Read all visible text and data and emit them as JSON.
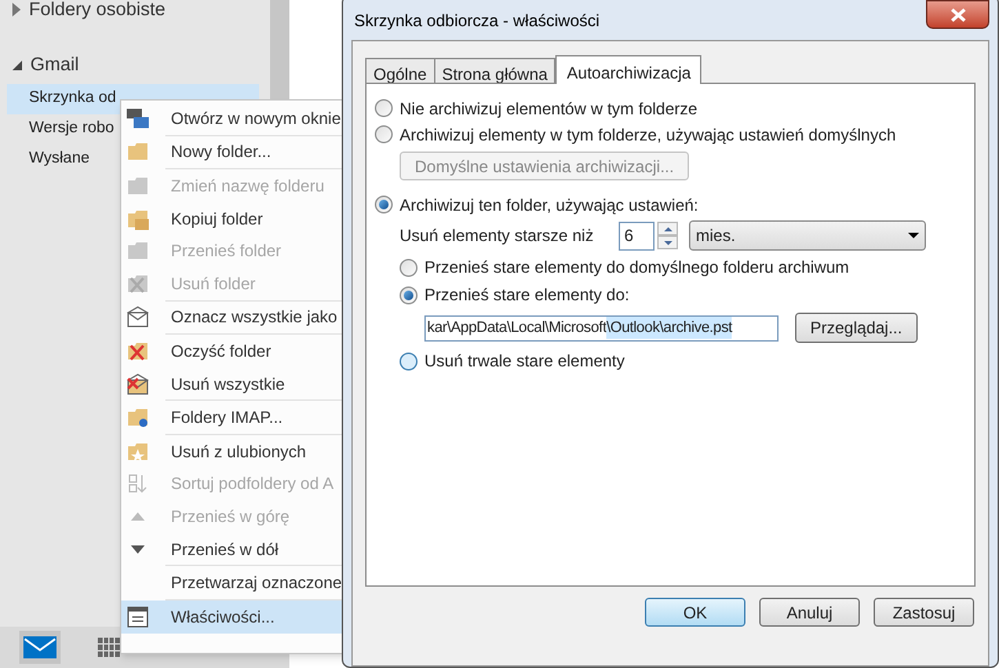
{
  "folder_pane": {
    "items": [
      {
        "label": "Foldery osobiste",
        "kind": "group",
        "expanded": false
      },
      {
        "label": "Gmail",
        "kind": "group",
        "expanded": true
      },
      {
        "label": "Skrzynka od",
        "kind": "folder",
        "selected": true
      },
      {
        "label": "Wersje robo",
        "kind": "folder",
        "selected": false
      },
      {
        "label": "Wysłane",
        "kind": "folder",
        "selected": false
      }
    ]
  },
  "nav_bar": {
    "items": [
      {
        "kind": "mail",
        "selected": true
      },
      {
        "kind": "calendar",
        "selected": false
      }
    ]
  },
  "context_menu": {
    "items": [
      {
        "label": "Otwórz w nowym oknie",
        "disabled": false,
        "selected": false,
        "separator_before": false
      },
      {
        "label": "Nowy folder...",
        "disabled": false,
        "selected": false,
        "separator_before": true
      },
      {
        "label": "Zmień nazwę folderu",
        "disabled": true,
        "selected": false,
        "separator_before": true
      },
      {
        "label": "Kopiuj folder",
        "disabled": false,
        "selected": false,
        "separator_before": false
      },
      {
        "label": "Przenieś folder",
        "disabled": true,
        "selected": false,
        "separator_before": false
      },
      {
        "label": "Usuń folder",
        "disabled": true,
        "selected": false,
        "separator_before": false
      },
      {
        "label": "Oznacz wszystkie jako",
        "disabled": false,
        "selected": false,
        "separator_before": true
      },
      {
        "label": "Oczyść folder",
        "disabled": false,
        "selected": false,
        "separator_before": true
      },
      {
        "label": "Usuń wszystkie",
        "disabled": false,
        "selected": false,
        "separator_before": false
      },
      {
        "label": "Foldery IMAP...",
        "disabled": false,
        "selected": false,
        "separator_before": true
      },
      {
        "label": "Usuń z ulubionych",
        "disabled": false,
        "selected": false,
        "separator_before": true
      },
      {
        "label": "Sortuj podfoldery od A",
        "disabled": true,
        "selected": false,
        "separator_before": false
      },
      {
        "label": "Przenieś w górę",
        "disabled": true,
        "selected": false,
        "separator_before": false
      },
      {
        "label": "Przenieś w dół",
        "disabled": false,
        "selected": false,
        "separator_before": false
      },
      {
        "label": "Przetwarzaj oznaczone",
        "disabled": false,
        "selected": false,
        "separator_before": true
      },
      {
        "label": "Właściwości...",
        "disabled": false,
        "selected": true,
        "separator_before": true
      }
    ]
  },
  "dialog": {
    "title": "Skrzynka odbiorcza - właściwości",
    "tabs": [
      {
        "label": "Ogólne",
        "selected": false
      },
      {
        "label": "Strona główna",
        "selected": false
      },
      {
        "label": "Autoarchiwizacja",
        "selected": true
      }
    ],
    "options": [
      {
        "label": "Nie archiwizuj elementów w tym folderze",
        "selected": false
      },
      {
        "label": "Archiwizuj elementy w tym folderze, używając ustawień domyślnych",
        "selected": false
      },
      {
        "label": "Archiwizuj ten folder, używając ustawień:",
        "selected": true
      }
    ],
    "default_settings_button": {
      "label": "Domyślne ustawienia archiwizacji...",
      "disabled": true
    },
    "age": {
      "label": "Usuń elementy starsze niż",
      "value": "6",
      "unit": "mies."
    },
    "sub_options": [
      {
        "label": "Przenieś stare elementy do domyślnego folderu archiwum",
        "selected": false
      },
      {
        "label": "Przenieś stare elementy do:",
        "selected": true
      }
    ],
    "path": {
      "value_plain": "kar\\AppData\\Local\\Microsoft",
      "value_selected": "\\Outlook\\archive.pst"
    },
    "browse_button": "Przeglądaj...",
    "delete_option": {
      "label": "Usuń trwale stare elementy",
      "selected": false
    },
    "buttons": [
      "OK",
      "Anuluj",
      "Zastosuj"
    ]
  }
}
